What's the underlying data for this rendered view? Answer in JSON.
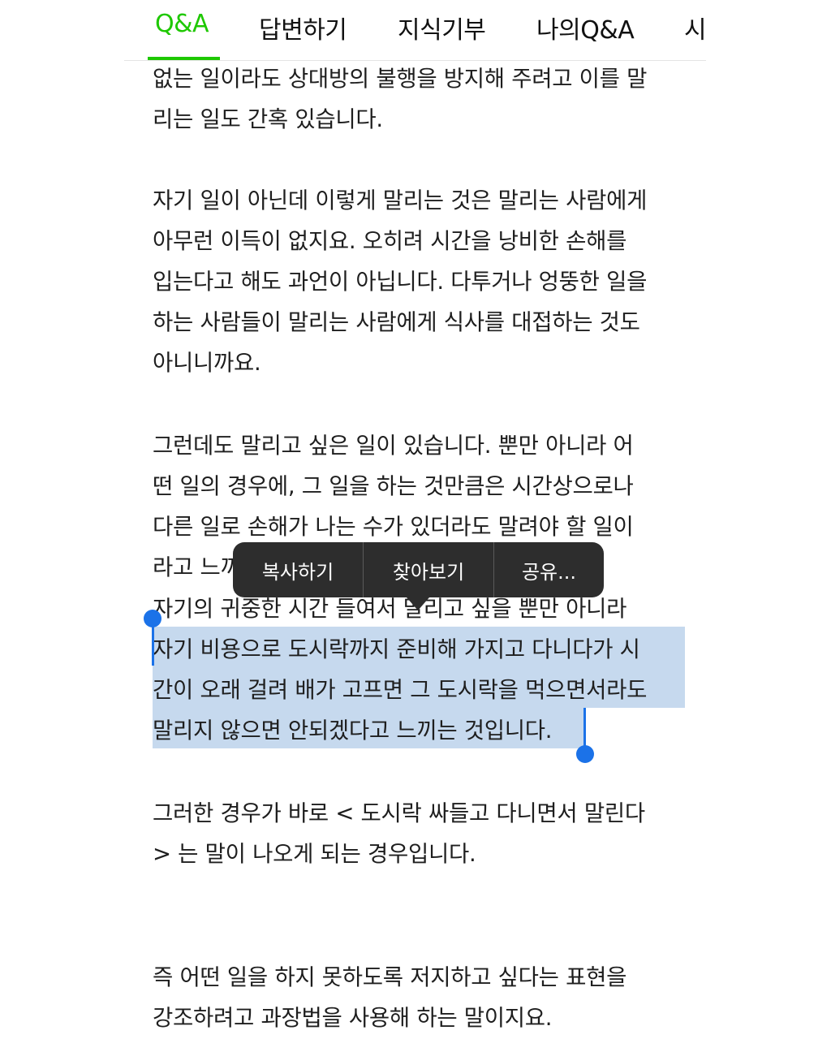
{
  "tabs": {
    "qa": "Q&A",
    "answer": "답변하기",
    "donate": "지식기부",
    "my_qa": "나의Q&A",
    "partial": "시"
  },
  "body": {
    "line_01": "없는 일이라도 상대방의 불행을 방지해 주려고 이를 말",
    "line_02": "리는 일도 간혹 있습니다.",
    "line_03": "자기 일이 아닌데 이렇게 말리는 것은 말리는 사람에게",
    "line_04": "아무런 이득이 없지요. 오히려 시간을 낭비한 손해를",
    "line_05": "입는다고 해도 과언이 아닙니다. 다투거나 엉뚱한 일을",
    "line_06": "하는 사람들이 말리는 사람에게 식사를 대접하는 것도",
    "line_07": "아니니까요.",
    "line_08": "그런데도 말리고 싶은 일이 있습니다. 뿐만 아니라 어",
    "line_09": "떤 일의 경우에, 그 일을 하는 것만큼은 시간상으로나",
    "line_10": "다른 일로 손해가 나는 수가 있더라도 말려야 할 일이",
    "line_11": "라고 느끼",
    "line_12": "자기의 귀중한 시간 들여서 말리고 싶을 뿐만 아니라",
    "line_13": "자기 비용으로 도시락까지 준비해 가지고 다니다가 시",
    "line_14": "간이 오래 걸려 배가 고프면 그 도시락을 먹으면서라도",
    "line_15": "말리지 않으면 안되겠다고 느끼는 것입니다.",
    "line_16": "그러한 경우가 바로 < 도시락 싸들고 다니면서 말린다",
    "line_17": "> 는 말이 나오게 되는 경우입니다.",
    "line_18": "즉 어떤 일을 하지 못하도록 저지하고 싶다는 표현을",
    "line_19": "강조하려고 과장법을 사용해 하는 말이지요."
  },
  "context_menu": {
    "copy": "복사하기",
    "lookup": "찾아보기",
    "share": "공유..."
  },
  "colors": {
    "accent": "#1ec800",
    "selection": "#c6d9ee",
    "handle": "#1b72e8",
    "menu_bg": "#2d2d2d"
  }
}
